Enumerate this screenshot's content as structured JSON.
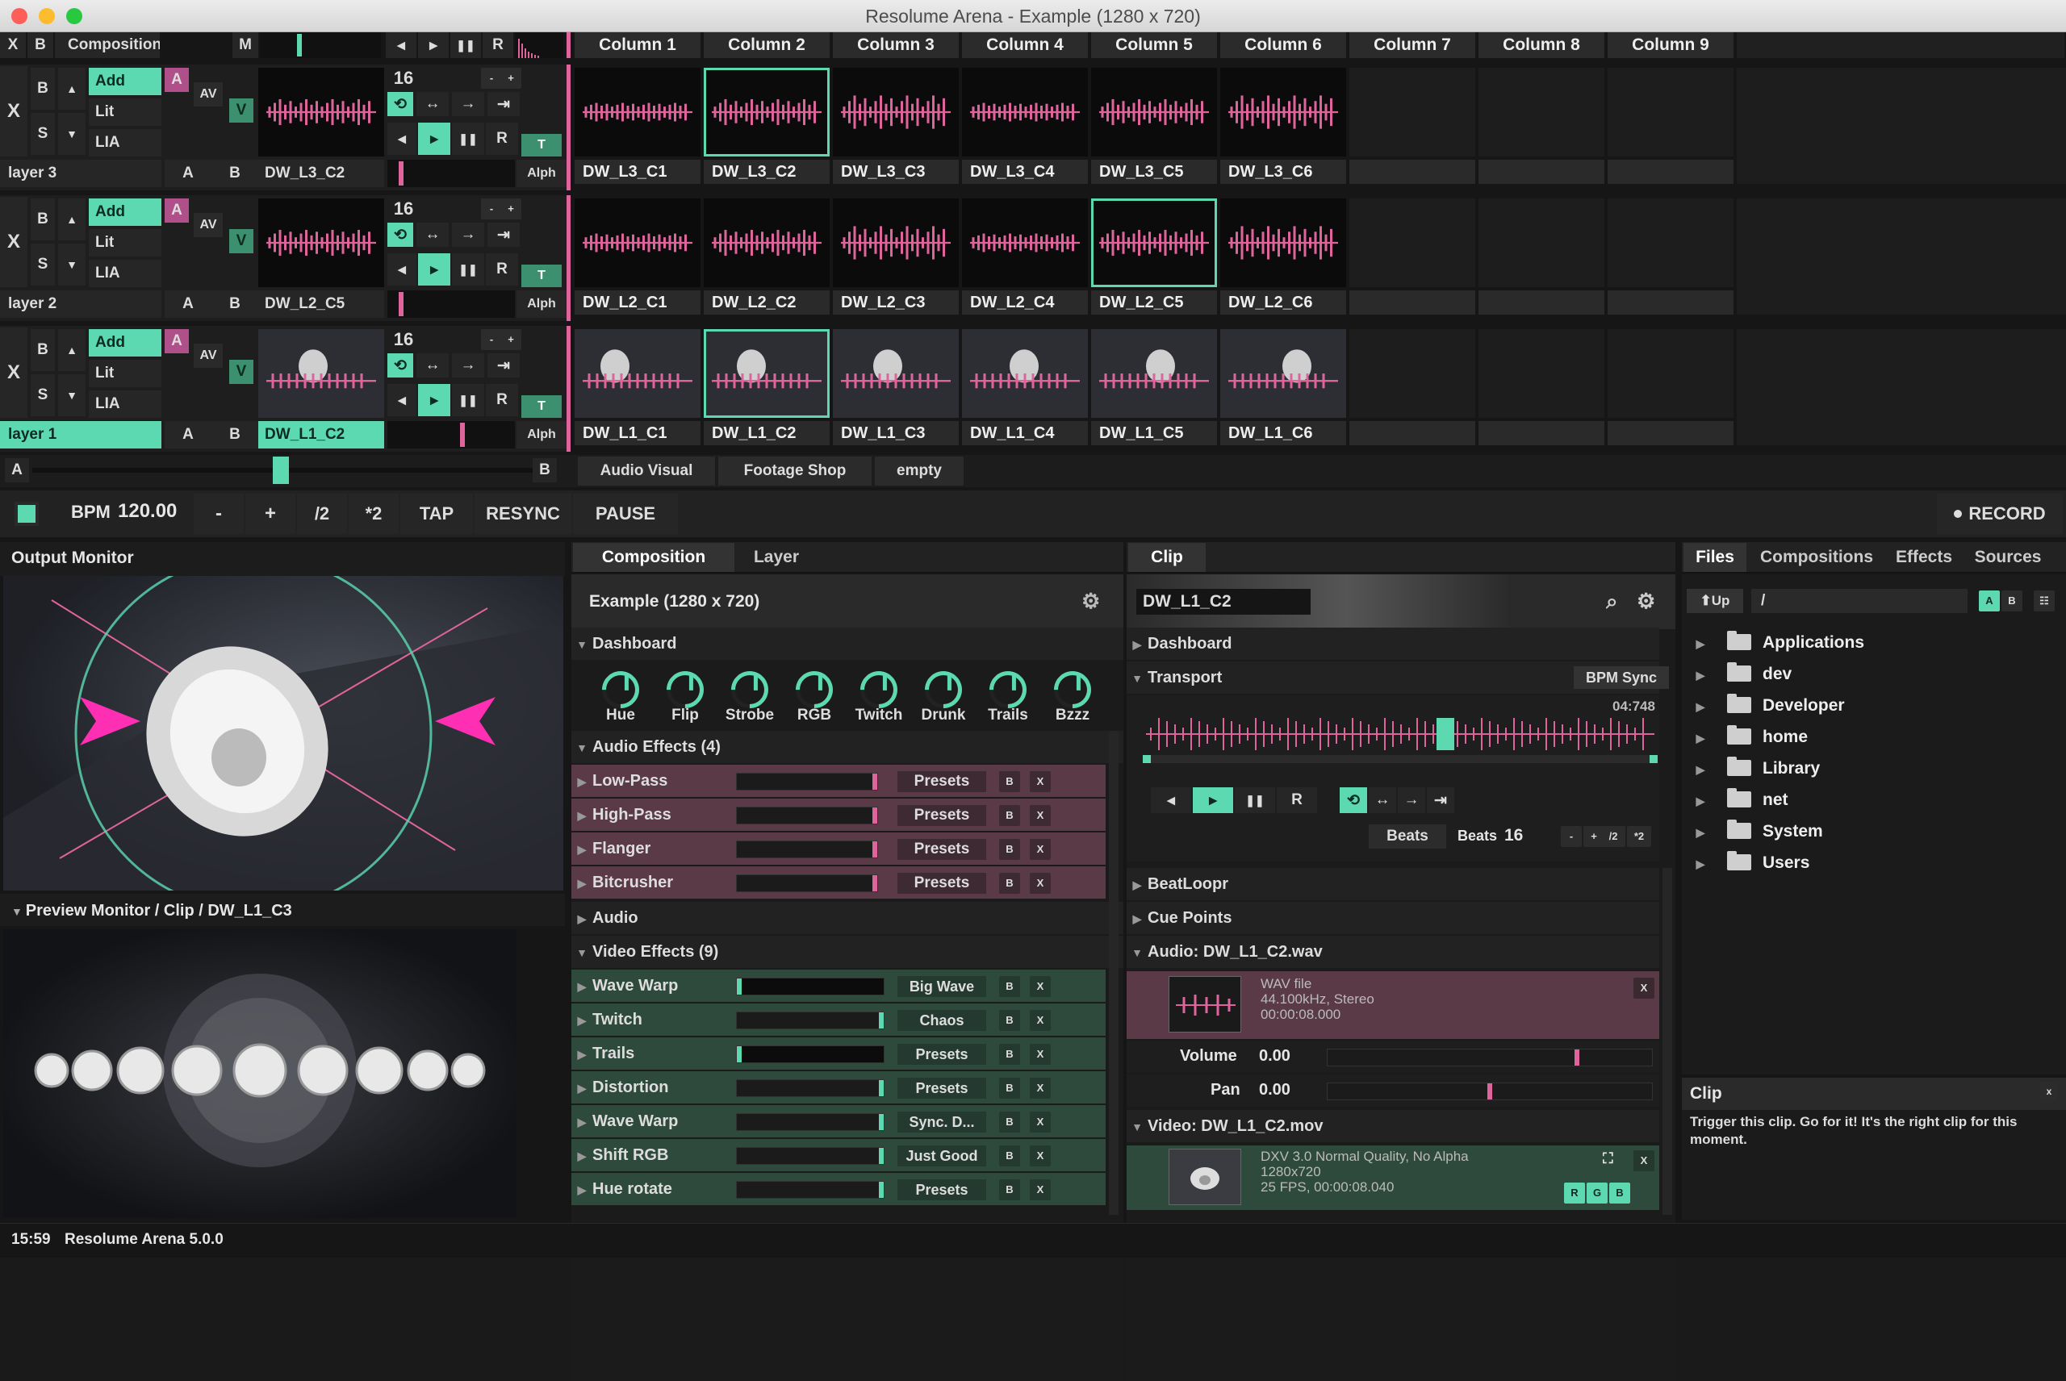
{
  "window": {
    "title": "Resolume Arena - Example (1280 x 720)"
  },
  "topleft": {
    "x": "X",
    "b": "B",
    "composition": "Composition",
    "m": "M"
  },
  "transport_small": {
    "prev": "◂",
    "play": "▸",
    "pause": "❚❚",
    "r": "R",
    "beats": "16",
    "minus": "-",
    "plus": "+"
  },
  "columns": [
    "Column 1",
    "Column 2",
    "Column 3",
    "Column 4",
    "Column 5",
    "Column 6",
    "Column 7",
    "Column 8",
    "Column 9"
  ],
  "layers": [
    {
      "name": "layer 3",
      "blend": "Add",
      "opts": [
        "Lit",
        "LIA"
      ],
      "current": "DW_L3_C2",
      "clips": [
        "DW_L3_C1",
        "DW_L3_C2",
        "DW_L3_C3",
        "DW_L3_C4",
        "DW_L3_C5",
        "DW_L3_C6"
      ]
    },
    {
      "name": "layer 2",
      "blend": "Add",
      "opts": [
        "Lit",
        "LIA"
      ],
      "current": "DW_L2_C5",
      "clips": [
        "DW_L2_C1",
        "DW_L2_C2",
        "DW_L2_C3",
        "DW_L2_C4",
        "DW_L2_C5",
        "DW_L2_C6"
      ]
    },
    {
      "name": "layer 1",
      "blend": "Add",
      "opts": [
        "Lit",
        "LIA"
      ],
      "current": "DW_L1_C2",
      "clips": [
        "DW_L1_C1",
        "DW_L1_C2",
        "DW_L1_C3",
        "DW_L1_C4",
        "DW_L1_C5",
        "DW_L1_C6"
      ]
    }
  ],
  "layer_controls": {
    "x": "X",
    "b": "B",
    "s": "S",
    "a": "A",
    "av": "AV",
    "v": "V",
    "t": "T",
    "alph": "Alph",
    "ab_a": "A",
    "ab_b": "B"
  },
  "deck": {
    "a": "A",
    "b": "B",
    "tabs": [
      "Audio Visual",
      "Footage Shop",
      "empty"
    ]
  },
  "bpm": {
    "label": "BPM",
    "value": "120.00",
    "minus": "-",
    "plus": "+",
    "half": "/2",
    "double": "*2",
    "tap": "TAP",
    "resync": "RESYNC",
    "pause": "PAUSE",
    "record": "RECORD"
  },
  "output": {
    "title": "Output Monitor",
    "preview": "Preview Monitor / Clip / DW_L1_C3"
  },
  "composition_panel": {
    "tabs": [
      "Composition",
      "Layer"
    ],
    "name": "Example (1280 x 720)",
    "dashboard": "Dashboard",
    "knobs": [
      "Hue",
      "Flip",
      "Strobe",
      "RGB",
      "Twitch",
      "Drunk",
      "Trails",
      "Bzzz"
    ],
    "audio_header": "Audio Effects (4)",
    "audio_fx": [
      {
        "name": "Low-Pass",
        "preset": "Presets"
      },
      {
        "name": "High-Pass",
        "preset": "Presets"
      },
      {
        "name": "Flanger",
        "preset": "Presets"
      },
      {
        "name": "Bitcrusher",
        "preset": "Presets"
      }
    ],
    "audio": "Audio",
    "video_header": "Video Effects (9)",
    "video_fx": [
      {
        "name": "Wave Warp",
        "preset": "Big Wave"
      },
      {
        "name": "Twitch",
        "preset": "Chaos"
      },
      {
        "name": "Trails",
        "preset": "Presets"
      },
      {
        "name": "Distortion",
        "preset": "Presets"
      },
      {
        "name": "Wave Warp",
        "preset": "Sync. D..."
      },
      {
        "name": "Shift RGB",
        "preset": "Just Good"
      },
      {
        "name": "Hue rotate",
        "preset": "Presets"
      }
    ],
    "b": "B",
    "x": "X"
  },
  "clip_panel": {
    "tab": "Clip",
    "name": "DW_L1_C2",
    "dashboard": "Dashboard",
    "transport": "Transport",
    "bpm_sync": "BPM Sync",
    "time": "04:748",
    "beats_mode": "Beats",
    "beats_label": "Beats",
    "beats_value": "16",
    "minus": "-",
    "plus": "+",
    "half": "/2",
    "double": "*2",
    "beatloopr": "BeatLoopr",
    "cue": "Cue Points",
    "audio_title": "Audio: DW_L1_C2.wav",
    "audio_info": [
      "WAV file",
      "44.100kHz, Stereo",
      "00:00:08.000"
    ],
    "volume_label": "Volume",
    "volume": "0.00",
    "pan_label": "Pan",
    "pan": "0.00",
    "video_title": "Video: DW_L1_C2.mov",
    "video_info": [
      "DXV 3.0 Normal Quality, No Alpha",
      "1280x720",
      "25 FPS, 00:00:08.040"
    ],
    "rgb": [
      "R",
      "G",
      "B"
    ],
    "x": "X"
  },
  "files_panel": {
    "tabs": [
      "Files",
      "Compositions",
      "Effects",
      "Sources"
    ],
    "up": "Up",
    "path": "/",
    "a": "A",
    "b": "B",
    "folders": [
      "Applications",
      "dev",
      "Developer",
      "home",
      "Library",
      "net",
      "System",
      "Users"
    ]
  },
  "help": {
    "title": "Clip",
    "text": "Trigger this clip. Go for it! It's the right clip for this moment.",
    "x": "x"
  },
  "status": {
    "time": "15:59",
    "version": "Resolume Arena 5.0.0"
  },
  "colors": {
    "accent": "#5dd9b2",
    "pink": "#e0649c",
    "audiofx": "#5a3a46",
    "videofx": "#2e4a3c"
  }
}
